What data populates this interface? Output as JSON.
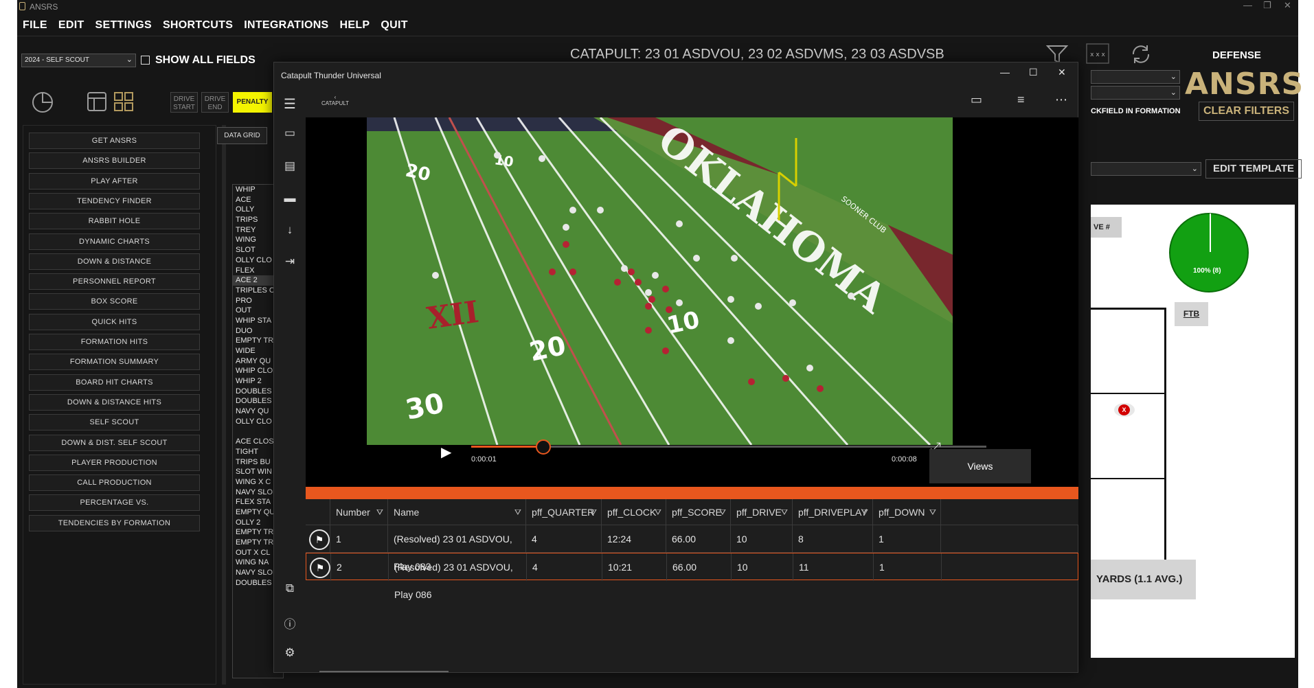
{
  "app": {
    "title": "ANSRS"
  },
  "menu": [
    "FILE",
    "EDIT",
    "SETTINGS",
    "SHORTCUTS",
    "INTEGRATIONS",
    "HELP",
    "QUIT"
  ],
  "season_select": "2024 - SELF SCOUT",
  "show_all_fields": "SHOW ALL FIELDS",
  "drive_start": [
    "DRIVE",
    "START"
  ],
  "drive_end": [
    "DRIVE",
    "END"
  ],
  "penalty": "PENALTY",
  "nav_buttons": [
    "GET ANSRS",
    "ANSRS BUILDER",
    "PLAY AFTER",
    "TENDENCY FINDER",
    "RABBIT HOLE",
    "DYNAMIC CHARTS",
    "DOWN & DISTANCE",
    "PERSONNEL REPORT",
    "BOX SCORE",
    "QUICK HITS",
    "FORMATION HITS",
    "FORMATION SUMMARY",
    "BOARD HIT CHARTS",
    "DOWN & DISTANCE HITS",
    "SELF SCOUT",
    "DOWN & DIST. SELF SCOUT",
    "PLAYER PRODUCTION",
    "CALL PRODUCTION",
    "PERCENTAGE VS.",
    "TENDENCIES BY FORMATION"
  ],
  "data_grid_tab": "DATA GRID",
  "formations": [
    "WHIP",
    "ACE",
    "OLLY",
    "TRIPS",
    "TREY",
    "WING",
    "SLOT",
    "OLLY CLO",
    "FLEX",
    "ACE 2",
    "TRIPLES C",
    "PRO",
    "OUT",
    "WHIP STA",
    "DUO",
    "EMPTY TR",
    "WIDE",
    "ARMY QU",
    "WHIP CLO",
    "WHIP 2",
    "DOUBLES",
    "DOUBLES",
    "NAVY QU",
    "OLLY CLO",
    "",
    "ACE CLOS",
    "TIGHT",
    "TRIPS BU",
    "SLOT WIN",
    "WING X C",
    "NAVY SLO",
    "FLEX STA",
    "EMPTY QU",
    "OLLY 2",
    "EMPTY TR",
    "EMPTY TR",
    "OUT X CL",
    "WING NA",
    "NAVY SLO",
    "DOUBLES"
  ],
  "header": "CATAPULT: 23 01 ASDVOU, 23 02 ASDVMS, 23 03 ASDVSB",
  "defense_label": "DEFENSE",
  "logo_text": "ANSRS",
  "clear_filters": "CLEAR FILTERS",
  "backfield_label": "CKFIELD IN FORMATION",
  "edit_template": "EDIT TEMPLATE",
  "pie_label": "100% (8)",
  "ftb": "FTB",
  "veh_label": "VE #",
  "yards_label": "YARDS (1.1 AVG.)",
  "marker": "X",
  "player": {
    "title": "Catapult Thunder Universal",
    "logo": "CATAPULT",
    "time_current": "0:00:01",
    "time_end": "0:00:08",
    "progress": 0.14,
    "views": "Views",
    "columns": [
      "Number",
      "Name",
      "pff_QUARTER",
      "pff_CLOCK",
      "pff_SCORE",
      "pff_DRIVE",
      "pff_DRIVEPLAY",
      "pff_DOWN"
    ],
    "rows": [
      [
        "1",
        "(Resolved) 23 01 ASDVOU, Play 083",
        "4",
        "12:24",
        "66.00",
        "10",
        "8",
        "1"
      ],
      [
        "2",
        "(Resolved) 23 01 ASDVOU, Play 086",
        "4",
        "10:21",
        "66.00",
        "10",
        "11",
        "1"
      ]
    ]
  },
  "field_text": {
    "endzone": "OKLAHOMA",
    "club": "SOONER CLUB",
    "yard_numbers": [
      "20",
      "10",
      "20",
      "30",
      "10"
    ],
    "logo": "XII"
  }
}
